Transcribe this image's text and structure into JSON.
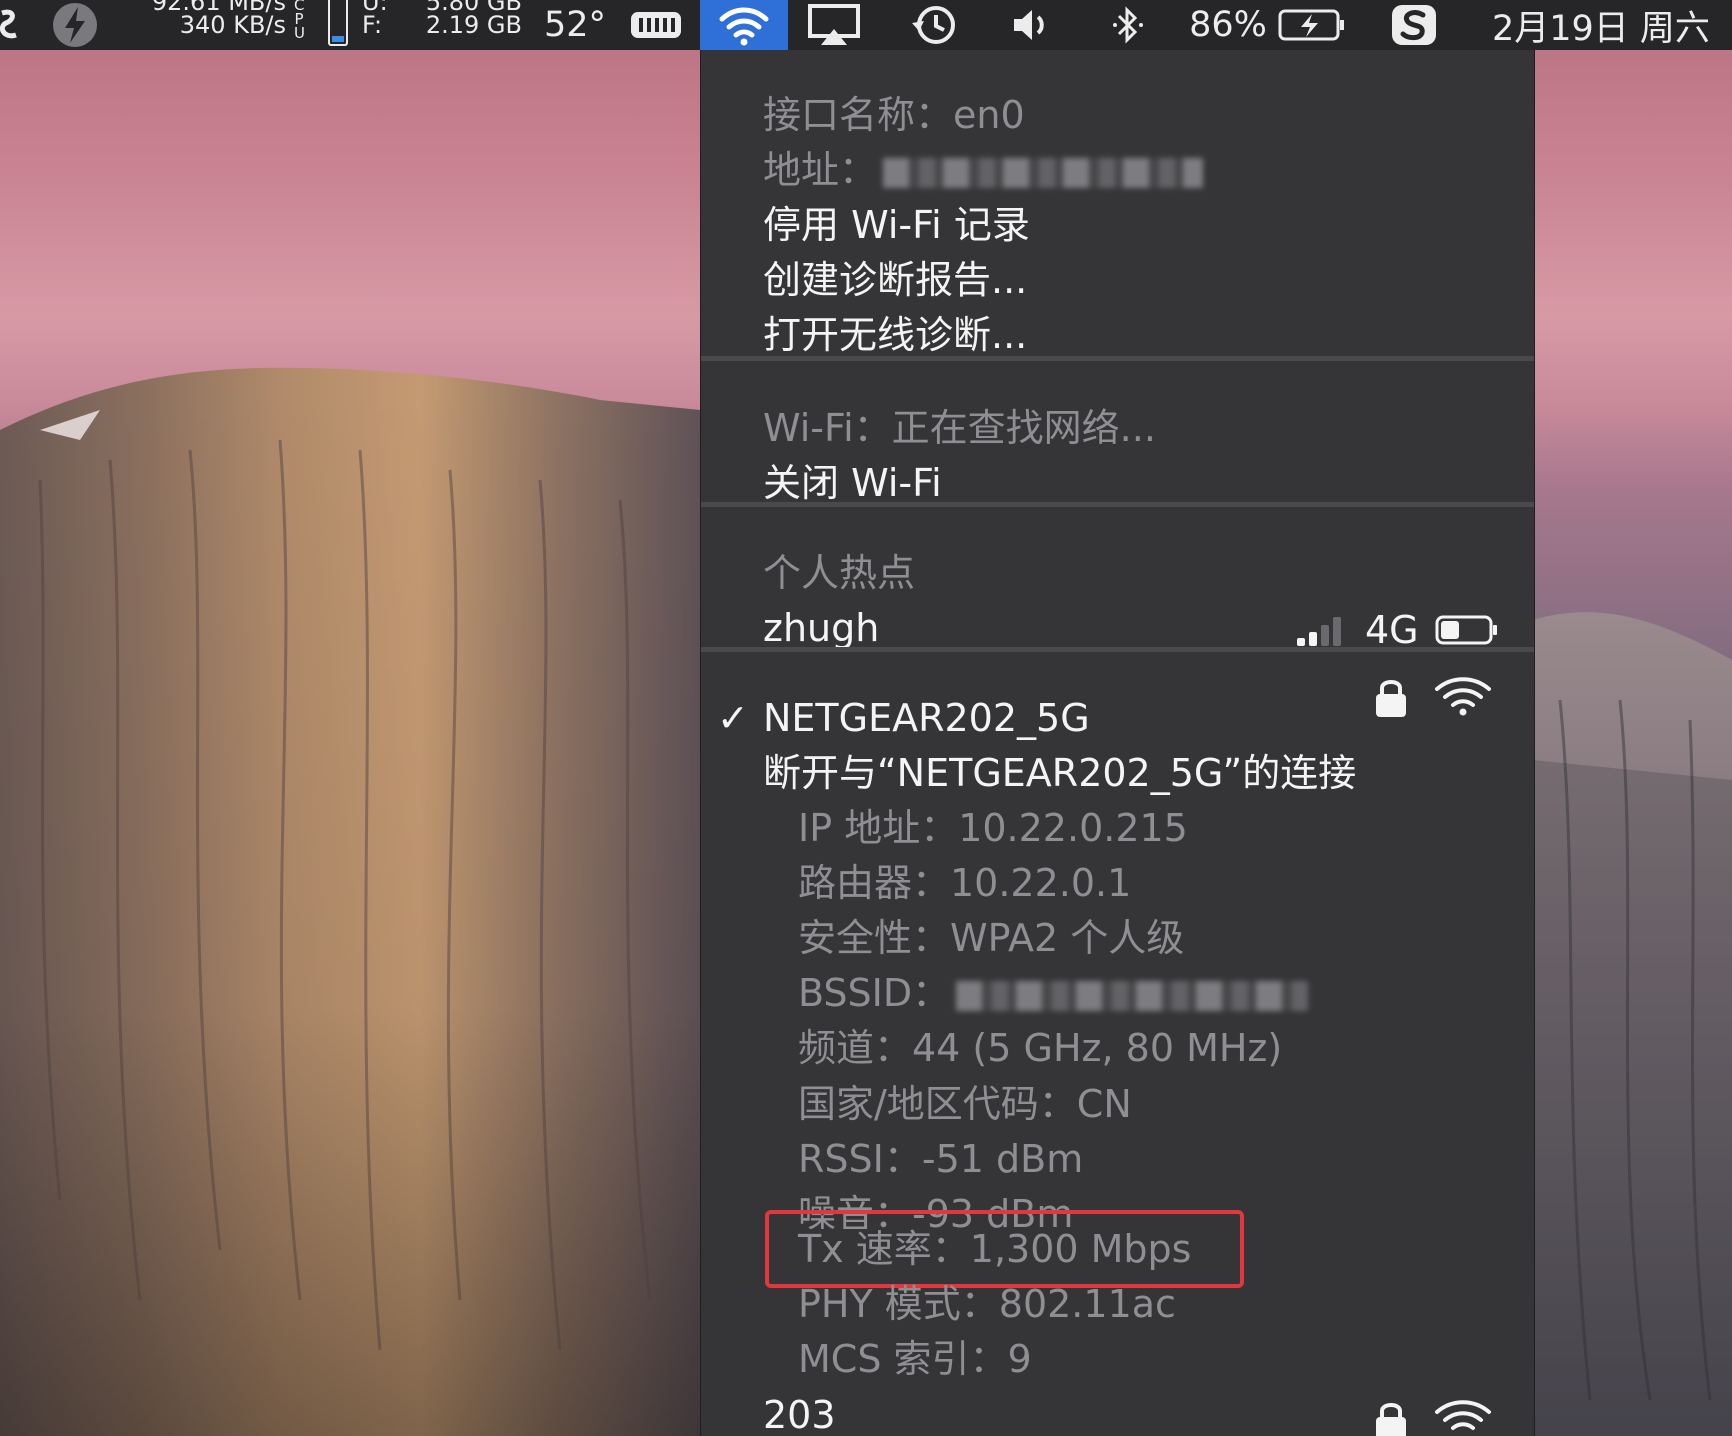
{
  "menubar": {
    "net_down": "92.61 MB/s",
    "net_up": "340 KB/s",
    "cpu_label": "CPU",
    "mem_u_label": "U:",
    "mem_f_label": "F:",
    "mem_used": "5.80 GB",
    "mem_free": "2.19 GB",
    "temperature": "52°",
    "battery_percent": "86%",
    "date": "2月19日 周六",
    "icons": [
      "app-s-icon",
      "bolt-icon",
      "cpu-bar-icon",
      "memory-icon",
      "wifi-icon",
      "airplay-icon",
      "time-machine-icon",
      "volume-icon",
      "bluetooth-icon",
      "battery-charging-icon",
      "sogou-input-icon"
    ],
    "accent_color": "#2e6fd8"
  },
  "menu": {
    "interface_name": "接口名称：en0",
    "address_label": "地址：",
    "disable_wifi_logging": "停用 Wi-Fi 记录",
    "create_diagnostics": "创建诊断报告...",
    "open_wireless_diagnostics": "打开无线诊断...",
    "wifi_status": "Wi-Fi：正在查找网络...",
    "turn_off_wifi": "关闭 Wi-Fi",
    "hotspot_header": "个人热点",
    "hotspot_name": "zhugh",
    "hotspot_network": "4G",
    "hotspot_signal_bars": 2,
    "hotspot_battery_level": 0.4,
    "connected_network": "NETGEAR202_5G",
    "disconnect": "断开与“NETGEAR202_5G”的连接",
    "details": {
      "ip": "IP 地址：10.22.0.215",
      "router": "路由器：10.22.0.1",
      "security": "安全性：WPA2 个人级",
      "bssid_label": "BSSID：",
      "channel": "频道：44 (5 GHz, 80 MHz)",
      "country": "国家/地区代码：CN",
      "rssi": "RSSI：-51 dBm",
      "noise": "噪音：-93 dBm",
      "tx_rate": "Tx 速率：1,300 Mbps",
      "phy_mode": "PHY 模式：802.11ac",
      "mcs_index": "MCS 索引：9"
    },
    "next_network": "203",
    "highlight_color": "#e0383e"
  }
}
